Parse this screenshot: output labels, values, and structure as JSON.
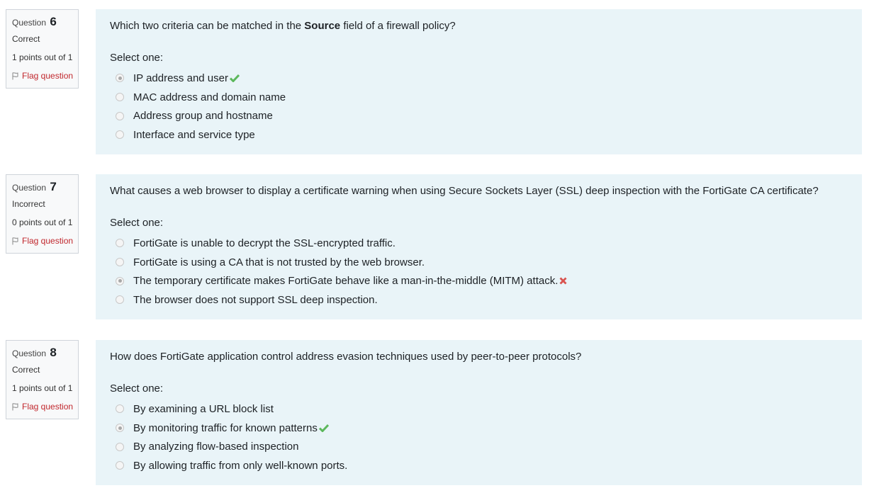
{
  "questions": [
    {
      "word": "Question",
      "number": "6",
      "state": "Correct",
      "grade": "1 points out of 1",
      "flag_label": "Flag question",
      "text_before": "Which two criteria can be matched in the ",
      "text_bold": "Source",
      "text_after": " field of a firewall policy?",
      "prompt": "Select one:",
      "answers": [
        {
          "label": "IP address and user",
          "checked": true,
          "mark": "check-icon"
        },
        {
          "label": "MAC address and domain name",
          "checked": false,
          "mark": ""
        },
        {
          "label": "Address group and hostname",
          "checked": false,
          "mark": ""
        },
        {
          "label": "Interface and service type",
          "checked": false,
          "mark": ""
        }
      ]
    },
    {
      "word": "Question",
      "number": "7",
      "state": "Incorrect",
      "grade": "0 points out of 1",
      "flag_label": "Flag question",
      "text_before": "What causes a web browser to display a certificate warning when using Secure Sockets Layer (SSL) deep inspection with the FortiGate CA certificate?",
      "text_bold": "",
      "text_after": "",
      "prompt": "Select one:",
      "answers": [
        {
          "label": "FortiGate is unable to decrypt the SSL-encrypted traffic.",
          "checked": false,
          "mark": ""
        },
        {
          "label": "FortiGate is using a CA that is not trusted by the web browser.",
          "checked": false,
          "mark": ""
        },
        {
          "label": "The temporary certificate makes FortiGate behave like a man-in-the-middle (MITM) attack.",
          "checked": true,
          "mark": "cross-icon"
        },
        {
          "label": "The browser does not support SSL deep inspection.",
          "checked": false,
          "mark": ""
        }
      ]
    },
    {
      "word": "Question",
      "number": "8",
      "state": "Correct",
      "grade": "1 points out of 1",
      "flag_label": "Flag question",
      "text_before": "How does FortiGate application control address evasion techniques used by peer-to-peer protocols?",
      "text_bold": "",
      "text_after": "",
      "prompt": "Select one:",
      "answers": [
        {
          "label": "By examining a URL block list",
          "checked": false,
          "mark": ""
        },
        {
          "label": "By monitoring traffic for known patterns",
          "checked": true,
          "mark": "check-icon"
        },
        {
          "label": "By analyzing flow-based inspection",
          "checked": false,
          "mark": ""
        },
        {
          "label": "By allowing traffic from only well-known ports.",
          "checked": false,
          "mark": ""
        }
      ]
    }
  ],
  "colors": {
    "panel_background": "#e9f4f8",
    "flag_text": "#c1272d",
    "check_mark": "#5cb85c",
    "cross_mark": "#d9534f"
  }
}
